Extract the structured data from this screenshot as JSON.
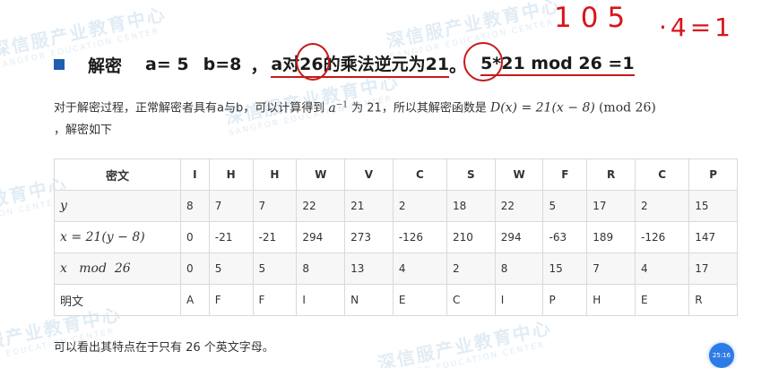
{
  "heading": {
    "bullet_color": "#1f5fae",
    "title": "解密",
    "a_value": "a= 5",
    "b_value": "b=8",
    "comma": "，",
    "inverse_stmt": "a对26的乘法逆元为21",
    "period": "。",
    "check_expr": "5*21 mod 26 =1"
  },
  "handwriting": {
    "line1": "105",
    "line2": "·4=1",
    "color": "#d6161b"
  },
  "paragraph": {
    "text1": "对于解密过程，正常解密者具有a与b，可以计算得到",
    "math_inv": "a",
    "math_inv_exp": "−1",
    "text2": "为 21，所以其解密函数是",
    "math_func": "D(x) = 21(x − 8)",
    "math_mod": "(mod 26)",
    "text3": "，解密如下"
  },
  "table": {
    "header_label": "密文",
    "ciphertext": [
      "I",
      "H",
      "H",
      "W",
      "V",
      "C",
      "S",
      "W",
      "F",
      "R",
      "C",
      "P"
    ],
    "row_y_label": "y",
    "y": [
      "8",
      "7",
      "7",
      "22",
      "21",
      "2",
      "18",
      "22",
      "5",
      "17",
      "2",
      "15"
    ],
    "row_x_label": "x = 21(y − 8)",
    "x": [
      "0",
      "-21",
      "-21",
      "294",
      "273",
      "-126",
      "210",
      "294",
      "-63",
      "189",
      "-126",
      "147"
    ],
    "row_mod_label": "x   mod  26",
    "mod": [
      "0",
      "5",
      "5",
      "8",
      "13",
      "4",
      "2",
      "8",
      "15",
      "7",
      "4",
      "17"
    ],
    "plain_label": "明文",
    "plaintext": [
      "A",
      "F",
      "F",
      "I",
      "N",
      "E",
      "C",
      "I",
      "P",
      "H",
      "E",
      "R"
    ]
  },
  "footer": {
    "text": "可以看出其特点在于只有 26 个英文字母。"
  },
  "timer": {
    "label": "25:16",
    "color": "#2d7be6"
  },
  "watermark": {
    "cn": "深信服产业教育中心",
    "en": "SANGFOR EDUCATION CENTER"
  }
}
